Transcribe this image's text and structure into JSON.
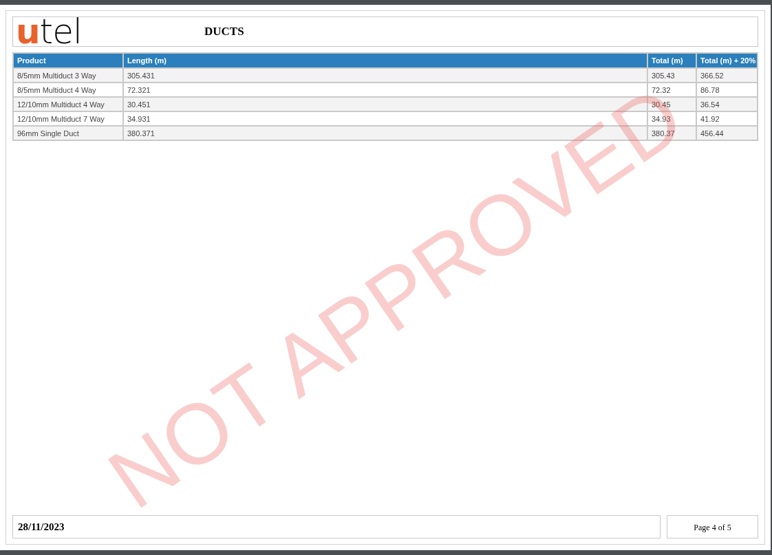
{
  "header": {
    "logo": {
      "accent": "u",
      "rest": "tel"
    },
    "title": "DUCTS"
  },
  "table": {
    "columns": [
      "Product",
      "Length (m)",
      "Total (m)",
      "Total (m) + 20%"
    ],
    "rows": [
      [
        "8/5mm Multiduct 3 Way",
        "305.431",
        "305.43",
        "366.52"
      ],
      [
        "8/5mm Multiduct 4 Way",
        "72.321",
        "72.32",
        "86.78"
      ],
      [
        "12/10mm Multiduct 4 Way",
        "30.451",
        "30.45",
        "36.54"
      ],
      [
        "12/10mm Multiduct 7 Way",
        "34.931",
        "34.93",
        "41.92"
      ],
      [
        "96mm Single Duct",
        "380.371",
        "380.37",
        "456.44"
      ]
    ]
  },
  "stamp": "NOT APPROVED",
  "footer": {
    "date": "28/11/2023",
    "page": "Page 4 of 5"
  }
}
